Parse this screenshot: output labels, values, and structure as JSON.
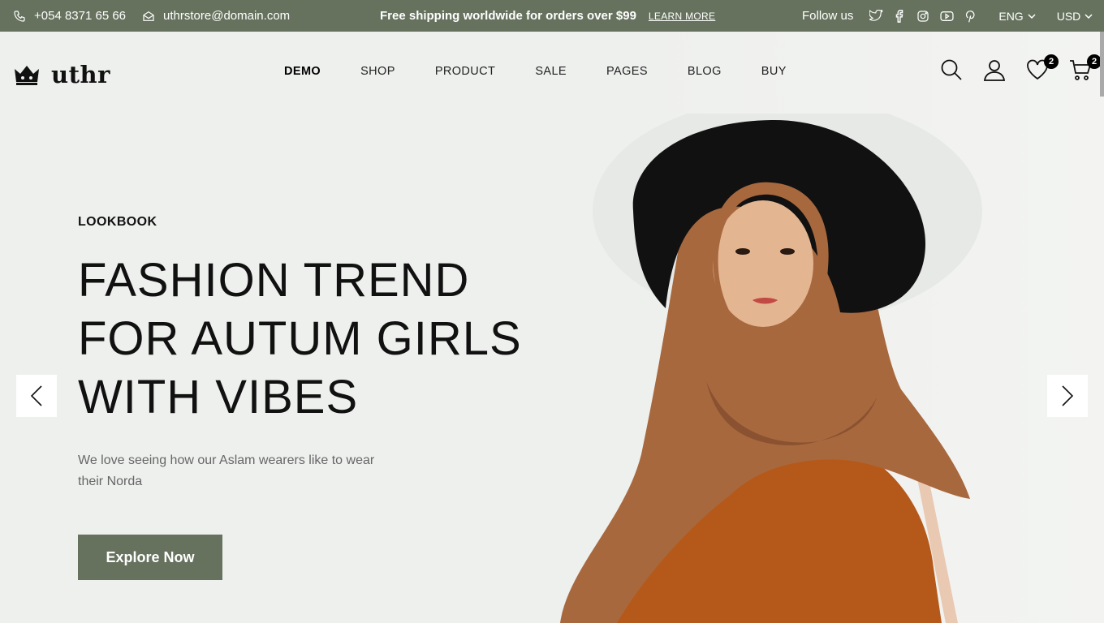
{
  "topbar": {
    "phone": "+054 8371 65 66",
    "email": "uthrstore@domain.com",
    "promo": "Free shipping worldwide for orders over $99",
    "learn_more": "LEARN MORE",
    "follow_label": "Follow us",
    "social_icons": [
      "twitter-icon",
      "facebook-icon",
      "instagram-icon",
      "youtube-icon",
      "pinterest-icon"
    ],
    "language": "ENG",
    "currency": "USD",
    "bg_color": "#66725e"
  },
  "header": {
    "logo_text": "uthr",
    "nav": [
      "DEMO",
      "SHOP",
      "PRODUCT",
      "SALE",
      "PAGES",
      "BLOG",
      "BUY"
    ],
    "active_nav": "DEMO",
    "wishlist_count": "2",
    "cart_count": "2"
  },
  "hero": {
    "eyebrow": "LOOKBOOK",
    "headline_line1": "FASHION TREND",
    "headline_line2": "FOR AUTUM GIRLS",
    "headline_line3": "WITH VIBES",
    "subtitle": "We love seeing how our Aslam wearers like to wear their Norda",
    "cta_label": "Explore Now",
    "cta_color": "#66725e"
  }
}
